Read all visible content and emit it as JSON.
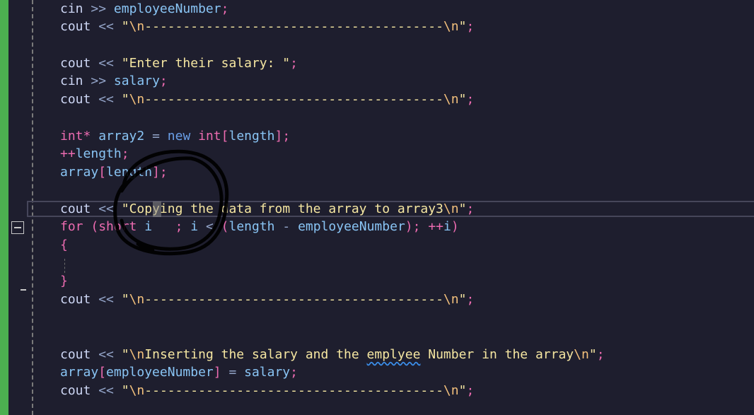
{
  "editor": {
    "colors": {
      "background": "#1e1e2e",
      "change_bar": "#4caf50",
      "keyword": "#ec6bb0",
      "string": "#f5e6a1",
      "variable": "#89c4f4"
    },
    "lines": {
      "l1": {
        "a": "cin",
        "b": ">>",
        "c": "employeeNumber",
        "d": ";"
      },
      "l2": {
        "a": "cout",
        "b": "<<",
        "q1": "\"",
        "e1": "\\n",
        "s": "---------------------------------------",
        "e2": "\\n",
        "q2": "\"",
        "d": ";"
      },
      "l3": {
        "a": "cout",
        "b": "<<",
        "s": "\"Enter their salary: \"",
        "d": ";"
      },
      "l4": {
        "a": "cin",
        "b": ">>",
        "c": "salary",
        "d": ";"
      },
      "l5": {
        "a": "cout",
        "b": "<<",
        "q1": "\"",
        "e1": "\\n",
        "s": "---------------------------------------",
        "e2": "\\n",
        "q2": "\"",
        "d": ";"
      },
      "l6": {
        "t1": "int",
        "t2": "*",
        "v": "array2",
        "eq": "=",
        "kw": "new",
        "t3": "int",
        "br1": "[",
        "len": "length",
        "br2": "]",
        "d": ";"
      },
      "l7": {
        "op": "++",
        "v": "length",
        "d": ";"
      },
      "l8": {
        "v": "array",
        "br1": "[",
        "len": "length",
        "br2": "]",
        "d": ";"
      },
      "l9": {
        "a": "cout",
        "b": "<<",
        "q1": "\"",
        "s": "Copying the data from the array to array3",
        "e1": "\\n",
        "q2": "\"",
        "d": ";"
      },
      "l10": {
        "kw": "for",
        "p1": "(",
        "ty": "short",
        "i1": "i",
        "sp": "   ",
        "semi1": ";",
        "i2": "i",
        "lt": "<",
        "p2": "(",
        "len": "length",
        "minus": "-",
        "emp": "employeeNumber",
        "p3": ")",
        "semi2": ";",
        "inc": "++",
        "i3": "i",
        "p4": ")"
      },
      "l11": {
        "brace": "{"
      },
      "l12": {
        "brace": "}"
      },
      "l13": {
        "a": "cout",
        "b": "<<",
        "q1": "\"",
        "e1": "\\n",
        "s": "---------------------------------------",
        "e2": "\\n",
        "q2": "\"",
        "d": ";"
      },
      "l14": {
        "a": "cout",
        "b": "<<",
        "q1": "\"",
        "e1": "\\n",
        "s1": "Inserting the salary and the ",
        "typo": "emplyee",
        "s2": " Number in the array",
        "e2": "\\n",
        "q2": "\"",
        "d": ";"
      },
      "l15": {
        "v": "array",
        "br1": "[",
        "emp": "employeeNumber",
        "br2": "]",
        "eq": "=",
        "sal": "salary",
        "d": ";"
      },
      "l16": {
        "a": "cout",
        "b": "<<",
        "q1": "\"",
        "e1": "\\n",
        "s": "---------------------------------------",
        "e2": "\\n",
        "q2": "\"",
        "d": ";"
      }
    }
  }
}
